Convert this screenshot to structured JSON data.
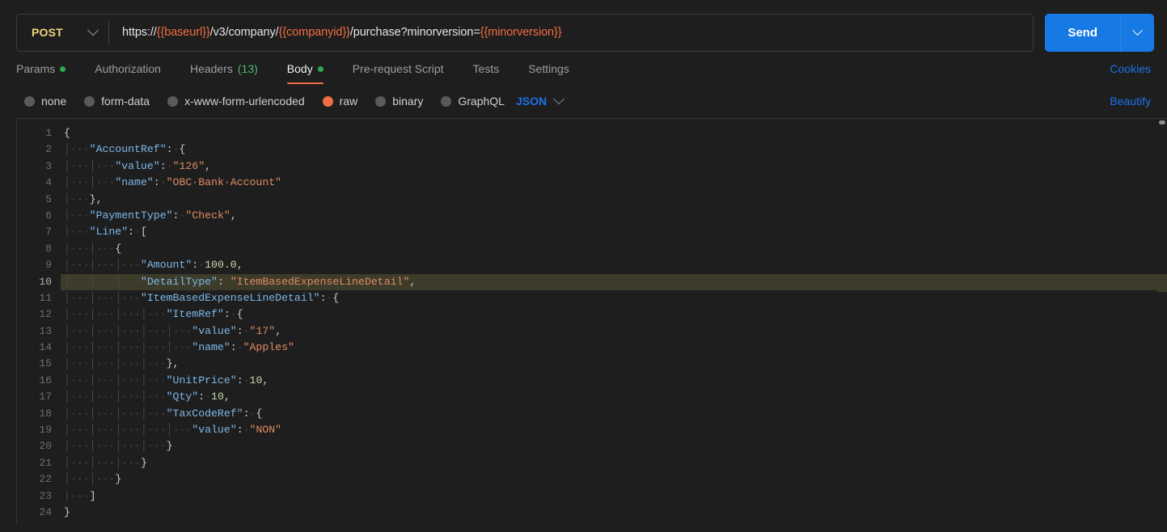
{
  "request": {
    "method": "POST",
    "method_caret_icon": "chevron-down-icon",
    "url_segments": [
      {
        "text": "https://",
        "variable": false
      },
      {
        "text": "{{baseurl}}",
        "variable": true
      },
      {
        "text": "/v3/company/",
        "variable": false
      },
      {
        "text": "{{companyid}}",
        "variable": true
      },
      {
        "text": "/purchase?minorversion=",
        "variable": false
      },
      {
        "text": "{{minorversion}}",
        "variable": true
      }
    ],
    "url_plain": "https://{{baseurl}}/v3/company/{{companyid}}/purchase?minorversion={{minorversion}}",
    "send_label": "Send",
    "send_caret_icon": "chevron-down-icon",
    "send_color": "#1779e3",
    "method_color": "#efd47a",
    "variable_color": "#f06e43"
  },
  "tabs": [
    {
      "label": "Params",
      "active": false,
      "dot": true,
      "count": ""
    },
    {
      "label": "Authorization",
      "active": false,
      "dot": false,
      "count": ""
    },
    {
      "label": "Headers",
      "active": false,
      "dot": false,
      "count": "(13)"
    },
    {
      "label": "Body",
      "active": true,
      "dot": true,
      "count": ""
    },
    {
      "label": "Pre-request Script",
      "active": false,
      "dot": false,
      "count": ""
    },
    {
      "label": "Tests",
      "active": false,
      "dot": false,
      "count": ""
    },
    {
      "label": "Settings",
      "active": false,
      "dot": false,
      "count": ""
    }
  ],
  "tabs_right": {
    "cookies_label": "Cookies",
    "link_color": "#1b72e8"
  },
  "body_types": [
    {
      "label": "none",
      "selected": false
    },
    {
      "label": "form-data",
      "selected": false
    },
    {
      "label": "x-www-form-urlencoded",
      "selected": false
    },
    {
      "label": "raw",
      "selected": true
    },
    {
      "label": "binary",
      "selected": false
    },
    {
      "label": "GraphQL",
      "selected": false
    }
  ],
  "body_format": {
    "label": "JSON",
    "caret_icon": "chevron-down-icon",
    "beautify_label": "Beautify"
  },
  "editor": {
    "active_line": 10,
    "active_line_color": "#3d3b2a",
    "total_lines": 24,
    "lines": [
      {
        "n": 1,
        "indent": 0,
        "tokens": [
          {
            "t": "{",
            "c": "p"
          }
        ]
      },
      {
        "n": 2,
        "indent": 1,
        "tokens": [
          {
            "t": "\"AccountRef\"",
            "c": "k"
          },
          {
            "t": ":",
            "c": "p"
          },
          {
            "t": "·",
            "c": "ws"
          },
          {
            "t": "{",
            "c": "p"
          }
        ]
      },
      {
        "n": 3,
        "indent": 2,
        "tokens": [
          {
            "t": "\"value\"",
            "c": "k"
          },
          {
            "t": ":",
            "c": "p"
          },
          {
            "t": "·",
            "c": "ws"
          },
          {
            "t": "\"126\"",
            "c": "s"
          },
          {
            "t": ",",
            "c": "p"
          }
        ]
      },
      {
        "n": 4,
        "indent": 2,
        "tokens": [
          {
            "t": "\"name\"",
            "c": "k"
          },
          {
            "t": ":",
            "c": "p"
          },
          {
            "t": "·",
            "c": "ws"
          },
          {
            "t": "\"OBC·Bank·Account\"",
            "c": "s"
          }
        ]
      },
      {
        "n": 5,
        "indent": 1,
        "tokens": [
          {
            "t": "}",
            "c": "p"
          },
          {
            "t": ",",
            "c": "p"
          }
        ]
      },
      {
        "n": 6,
        "indent": 1,
        "tokens": [
          {
            "t": "\"PaymentType\"",
            "c": "k"
          },
          {
            "t": ":",
            "c": "p"
          },
          {
            "t": "·",
            "c": "ws"
          },
          {
            "t": "\"Check\"",
            "c": "s"
          },
          {
            "t": ",",
            "c": "p"
          }
        ]
      },
      {
        "n": 7,
        "indent": 1,
        "tokens": [
          {
            "t": "\"Line\"",
            "c": "k"
          },
          {
            "t": ":",
            "c": "p"
          },
          {
            "t": "·",
            "c": "ws"
          },
          {
            "t": "[",
            "c": "p"
          }
        ]
      },
      {
        "n": 8,
        "indent": 2,
        "tokens": [
          {
            "t": "{",
            "c": "p"
          }
        ]
      },
      {
        "n": 9,
        "indent": 3,
        "tokens": [
          {
            "t": "\"Amount\"",
            "c": "k"
          },
          {
            "t": ":",
            "c": "p"
          },
          {
            "t": "·",
            "c": "ws"
          },
          {
            "t": "100.0",
            "c": "n"
          },
          {
            "t": ",",
            "c": "p"
          }
        ]
      },
      {
        "n": 10,
        "indent": 3,
        "tokens": [
          {
            "t": "\"DetailType\"",
            "c": "k"
          },
          {
            "t": ":",
            "c": "p"
          },
          {
            "t": " ",
            "c": "p"
          },
          {
            "t": "\"ItemBasedExpenseLineDetail\"",
            "c": "s"
          },
          {
            "t": ",",
            "c": "p"
          }
        ]
      },
      {
        "n": 11,
        "indent": 3,
        "tokens": [
          {
            "t": "\"ItemBasedExpenseLineDetail\"",
            "c": "k"
          },
          {
            "t": ":",
            "c": "p"
          },
          {
            "t": "·",
            "c": "ws"
          },
          {
            "t": "{",
            "c": "p"
          }
        ]
      },
      {
        "n": 12,
        "indent": 4,
        "tokens": [
          {
            "t": "\"ItemRef\"",
            "c": "k"
          },
          {
            "t": ":",
            "c": "p"
          },
          {
            "t": "·",
            "c": "ws"
          },
          {
            "t": "{",
            "c": "p"
          }
        ]
      },
      {
        "n": 13,
        "indent": 5,
        "tokens": [
          {
            "t": "\"value\"",
            "c": "k"
          },
          {
            "t": ":",
            "c": "p"
          },
          {
            "t": "·",
            "c": "ws"
          },
          {
            "t": "\"17\"",
            "c": "s"
          },
          {
            "t": ",",
            "c": "p"
          }
        ]
      },
      {
        "n": 14,
        "indent": 5,
        "tokens": [
          {
            "t": "\"name\"",
            "c": "k"
          },
          {
            "t": ":",
            "c": "p"
          },
          {
            "t": "·",
            "c": "ws"
          },
          {
            "t": "\"Apples\"",
            "c": "s"
          }
        ]
      },
      {
        "n": 15,
        "indent": 4,
        "tokens": [
          {
            "t": "}",
            "c": "p"
          },
          {
            "t": ",",
            "c": "p"
          }
        ]
      },
      {
        "n": 16,
        "indent": 4,
        "tokens": [
          {
            "t": "\"UnitPrice\"",
            "c": "k"
          },
          {
            "t": ":",
            "c": "p"
          },
          {
            "t": "·",
            "c": "ws"
          },
          {
            "t": "10",
            "c": "n"
          },
          {
            "t": ",",
            "c": "p"
          }
        ]
      },
      {
        "n": 17,
        "indent": 4,
        "tokens": [
          {
            "t": "\"Qty\"",
            "c": "k"
          },
          {
            "t": ":",
            "c": "p"
          },
          {
            "t": "·",
            "c": "ws"
          },
          {
            "t": "10",
            "c": "n"
          },
          {
            "t": ",",
            "c": "p"
          }
        ]
      },
      {
        "n": 18,
        "indent": 4,
        "tokens": [
          {
            "t": "\"TaxCodeRef\"",
            "c": "k"
          },
          {
            "t": ":",
            "c": "p"
          },
          {
            "t": "·",
            "c": "ws"
          },
          {
            "t": "{",
            "c": "p"
          }
        ]
      },
      {
        "n": 19,
        "indent": 5,
        "tokens": [
          {
            "t": "\"value\"",
            "c": "k"
          },
          {
            "t": ":",
            "c": "p"
          },
          {
            "t": "·",
            "c": "ws"
          },
          {
            "t": "\"NON\"",
            "c": "s"
          }
        ]
      },
      {
        "n": 20,
        "indent": 4,
        "tokens": [
          {
            "t": "}",
            "c": "p"
          }
        ]
      },
      {
        "n": 21,
        "indent": 3,
        "tokens": [
          {
            "t": "}",
            "c": "p"
          }
        ]
      },
      {
        "n": 22,
        "indent": 2,
        "tokens": [
          {
            "t": "}",
            "c": "p"
          }
        ]
      },
      {
        "n": 23,
        "indent": 1,
        "tokens": [
          {
            "t": "]",
            "c": "p"
          }
        ]
      },
      {
        "n": 24,
        "indent": 0,
        "tokens": [
          {
            "t": "}",
            "c": "p"
          }
        ]
      }
    ]
  }
}
